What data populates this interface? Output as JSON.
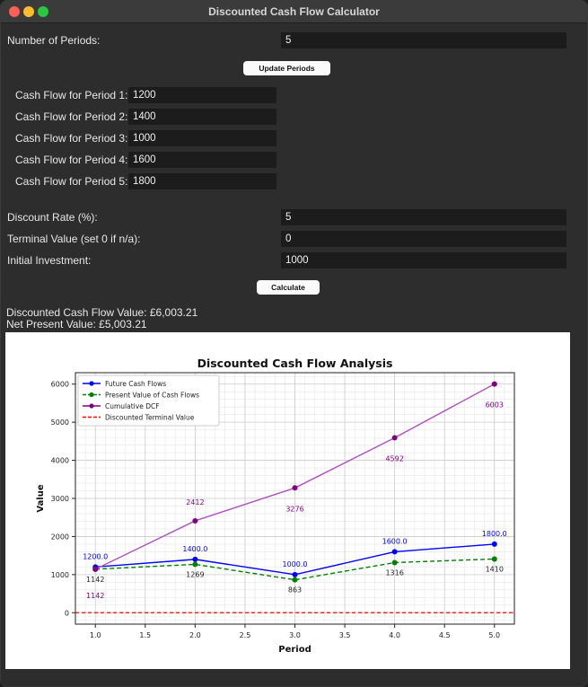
{
  "window": {
    "title": "Discounted Cash Flow Calculator"
  },
  "form": {
    "periods_label": "Number of Periods:",
    "periods_value": "5",
    "update_button": "Update Periods",
    "cash_flows": [
      {
        "label": "Cash Flow for Period 1:",
        "value": "1200"
      },
      {
        "label": "Cash Flow for Period 2:",
        "value": "1400"
      },
      {
        "label": "Cash Flow for Period 3:",
        "value": "1000"
      },
      {
        "label": "Cash Flow for Period 4:",
        "value": "1600"
      },
      {
        "label": "Cash Flow for Period 5:",
        "value": "1800"
      }
    ],
    "discount_label": "Discount Rate (%):",
    "discount_value": "5",
    "terminal_label": "Terminal Value (set 0 if n/a):",
    "terminal_value": "0",
    "investment_label": "Initial Investment:",
    "investment_value": "1000",
    "calculate_button": "Calculate"
  },
  "results": {
    "dcf": "Discounted Cash Flow Value: £6,003.21",
    "npv": "Net Present Value: £5,003.21"
  },
  "colors": {
    "future": "#0000ff",
    "present": "#008000",
    "cumulative": "#800080",
    "terminal": "#ff0000"
  },
  "chart_data": {
    "type": "line",
    "title": "Discounted Cash Flow Analysis",
    "xlabel": "Period",
    "ylabel": "Value",
    "xlim": [
      0.8,
      5.2
    ],
    "ylim": [
      -300,
      6300
    ],
    "xticks": [
      "1.0",
      "1.5",
      "2.0",
      "2.5",
      "3.0",
      "3.5",
      "4.0",
      "4.5",
      "5.0"
    ],
    "yticks": [
      "0",
      "1000",
      "2000",
      "3000",
      "4000",
      "5000",
      "6000"
    ],
    "grid": true,
    "legend": "top-left",
    "x": [
      1,
      2,
      3,
      4,
      5
    ],
    "series": [
      {
        "name": "Future Cash Flows",
        "values": [
          1200,
          1400,
          1000,
          1600,
          1800
        ],
        "labels": [
          "1200.0",
          "1400.0",
          "1000.0",
          "1600.0",
          "1800.0"
        ],
        "style": "solid"
      },
      {
        "name": "Present Value of Cash Flows",
        "values": [
          1142,
          1269,
          863,
          1316,
          1410
        ],
        "labels": [
          "1142",
          "1269",
          "863",
          "1316",
          "1410"
        ],
        "style": "dashed"
      },
      {
        "name": "Cumulative DCF",
        "values": [
          1142,
          2412,
          3276,
          4592,
          6003
        ],
        "labels": [
          "1142",
          "2412",
          "3276",
          "4592",
          "6003"
        ],
        "style": "solid"
      }
    ],
    "hline": {
      "name": "Discounted Terminal Value",
      "value": 0
    }
  }
}
